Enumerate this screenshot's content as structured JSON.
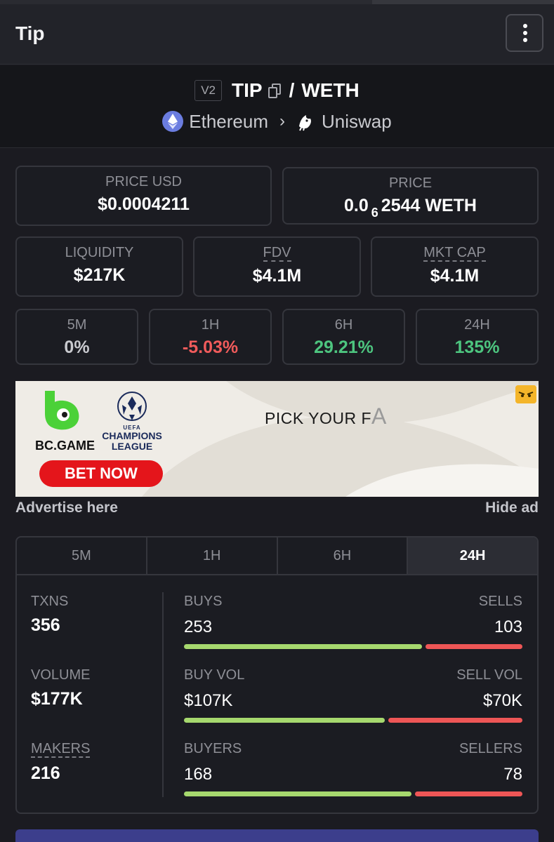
{
  "header": {
    "title": "Tip"
  },
  "pair": {
    "version": "V2",
    "base": "TIP",
    "separator": "/",
    "quote": "WETH",
    "chain": "Ethereum",
    "dex": "Uniswap"
  },
  "price": {
    "usd_label": "PRICE USD",
    "usd_value": "$0.0004211",
    "native_label": "PRICE",
    "native_prefix": "0.0",
    "native_zeros": "6",
    "native_digits": "2544 WETH"
  },
  "metrics": [
    {
      "label": "LIQUIDITY",
      "value": "$217K"
    },
    {
      "label": "FDV",
      "value": "$4.1M"
    },
    {
      "label": "MKT CAP",
      "value": "$4.1M"
    }
  ],
  "changes": [
    {
      "label": "5M",
      "value": "0%"
    },
    {
      "label": "1H",
      "value": "-5.03%"
    },
    {
      "label": "6H",
      "value": "29.21%"
    },
    {
      "label": "24H",
      "value": "135%"
    }
  ],
  "ad": {
    "brand": "BC.GAME",
    "league_top": "UEFA",
    "league_name": "CHAMPIONS LEAGUE",
    "tagline": "PICK YOUR F",
    "tagline_fade": "A",
    "cta": "BET NOW",
    "advertise": "Advertise here",
    "hide": "Hide ad"
  },
  "stats": {
    "tabs": [
      "5M",
      "1H",
      "6H",
      "24H"
    ],
    "active_tab": "24H",
    "txns_label": "TXNS",
    "txns_value": "356",
    "volume_label": "VOLUME",
    "volume_value": "$177K",
    "makers_label": "MAKERS",
    "makers_value": "216",
    "rows": [
      {
        "left_label": "BUYS",
        "right_label": "SELLS",
        "left_value": "253",
        "right_value": "103",
        "left_share": 0.71
      },
      {
        "left_label": "BUY VOL",
        "right_label": "SELL VOL",
        "left_value": "$107K",
        "right_value": "$70K",
        "left_share": 0.6
      },
      {
        "left_label": "BUYERS",
        "right_label": "SELLERS",
        "left_value": "168",
        "right_value": "78",
        "left_share": 0.68
      }
    ]
  },
  "colors": {
    "positive": "#4dc57f",
    "negative": "#f15b5b",
    "buy_bar": "#a6d86e",
    "sell_bar": "#ee5656"
  }
}
